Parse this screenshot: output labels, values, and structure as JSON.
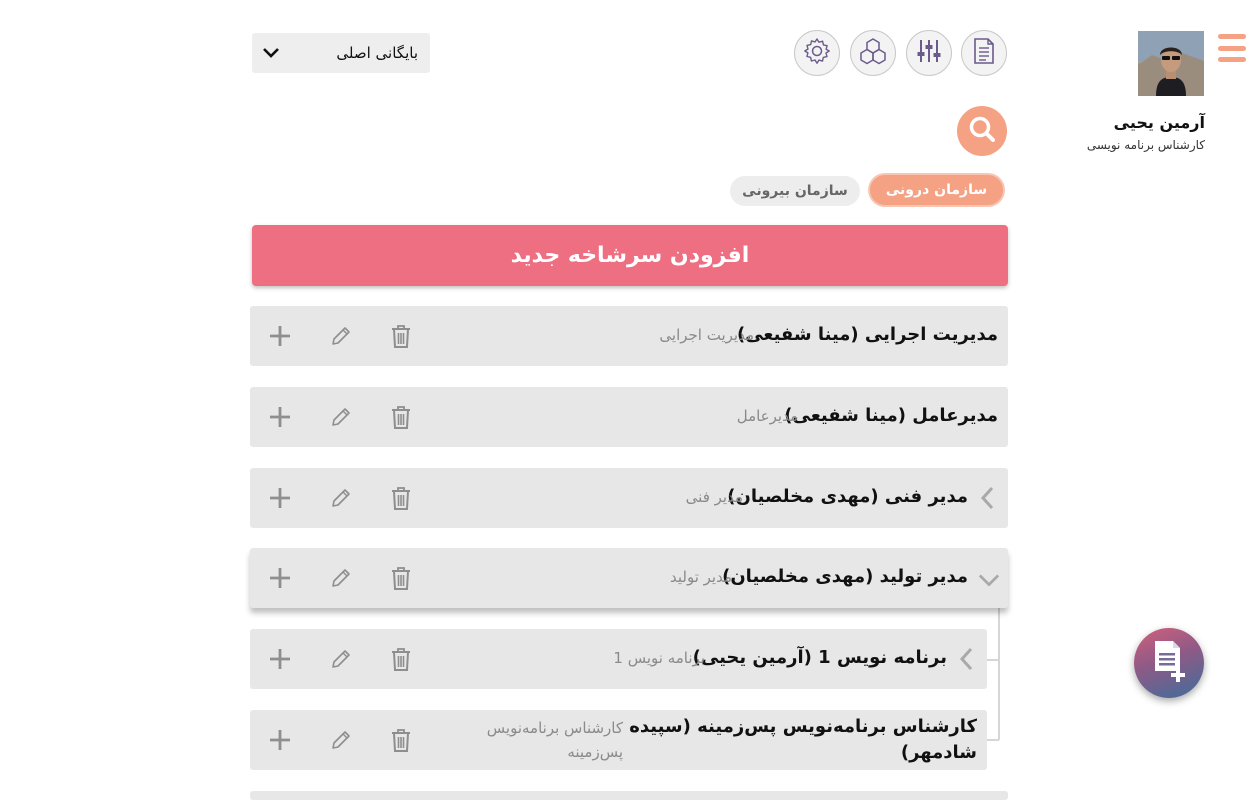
{
  "header": {
    "archive_select": {
      "value": "بایگانی اصلی"
    },
    "tools": [
      {
        "icon": "settings-icon"
      },
      {
        "icon": "network-icon"
      },
      {
        "icon": "sliders-icon"
      },
      {
        "icon": "document-icon"
      }
    ]
  },
  "search": {
    "icon": "search-icon"
  },
  "org_tabs": {
    "internal": "سازمان درونی",
    "external": "سازمان بیرونی"
  },
  "add_root_button": "افزودن سرشاخه جدید",
  "nodes": [
    {
      "title": "مدیریت اجرایی (مینا شفیعی)",
      "role": "مدیریت اجرایی"
    },
    {
      "title": "مدیرعامل (مینا شفیعی)",
      "role": "مدیرعامل"
    },
    {
      "title": "مدیر فنی (مهدی مخلصیان)",
      "role": "مدیر فنی"
    },
    {
      "title": "مدیر تولید (مهدی مخلصیان)",
      "role": "مدیر تولید"
    },
    {
      "title": "برنامه نویس 1 (آرمین یحیی)",
      "role": "برنامه نویس 1"
    },
    {
      "title_line1": "کارشناس برنامه‌نویس پس‌زمینه (سپیده",
      "title_line2": "شادمهر)",
      "role_line1": "کارشناس برنامه‌نویس",
      "role_line2": "پس‌زمینه"
    }
  ],
  "profile": {
    "name": "آرمین یحیی",
    "title": "کارشناس برنامه نویسی"
  },
  "colors": {
    "accent": "#f4a283",
    "add_button": "#ee6f81",
    "node_bg": "#e7e7e7"
  }
}
